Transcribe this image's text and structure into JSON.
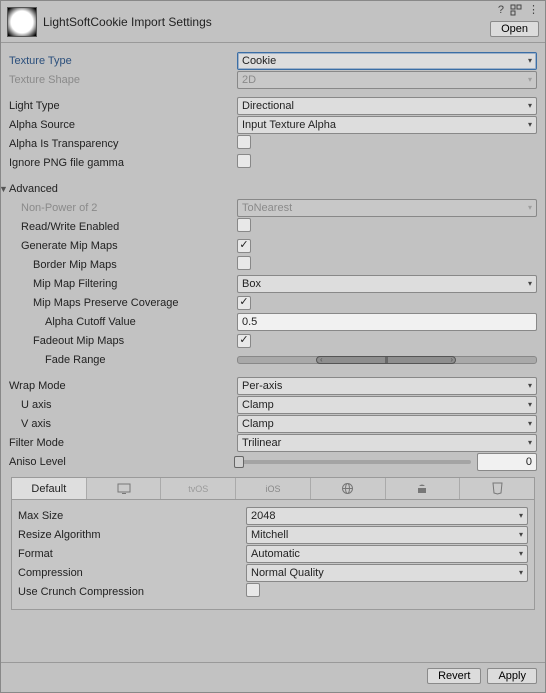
{
  "header": {
    "title": "LightSoftCookie Import Settings",
    "open": "Open"
  },
  "labels": {
    "textureType": "Texture Type",
    "textureShape": "Texture Shape",
    "lightType": "Light Type",
    "alphaSource": "Alpha Source",
    "alphaIsTransparency": "Alpha Is Transparency",
    "ignorePNG": "Ignore PNG file gamma",
    "advanced": "Advanced",
    "npo2": "Non-Power of 2",
    "readWrite": "Read/Write Enabled",
    "genMip": "Generate Mip Maps",
    "borderMip": "Border Mip Maps",
    "mipFiltering": "Mip Map Filtering",
    "mipCoverage": "Mip Maps Preserve Coverage",
    "alphaCutoff": "Alpha Cutoff Value",
    "fadeoutMip": "Fadeout Mip Maps",
    "fadeRange": "Fade Range",
    "wrapMode": "Wrap Mode",
    "uAxis": "U axis",
    "vAxis": "V axis",
    "filterMode": "Filter Mode",
    "anisoLevel": "Aniso Level",
    "maxSize": "Max Size",
    "resizeAlg": "Resize Algorithm",
    "format": "Format",
    "compression": "Compression",
    "crunch": "Use Crunch Compression"
  },
  "values": {
    "textureType": "Cookie",
    "textureShape": "2D",
    "lightType": "Directional",
    "alphaSource": "Input Texture Alpha",
    "alphaIsTransparency": false,
    "ignorePNG": false,
    "npo2": "ToNearest",
    "readWrite": false,
    "genMip": true,
    "borderMip": false,
    "mipFiltering": "Box",
    "mipCoverage": true,
    "alphaCutoff": "0.5",
    "fadeoutMip": true,
    "wrapMode": "Per-axis",
    "uAxis": "Clamp",
    "vAxis": "Clamp",
    "filterMode": "Trilinear",
    "anisoLevel": "0",
    "maxSize": "2048",
    "resizeAlg": "Mitchell",
    "format": "Automatic",
    "compression": "Normal Quality",
    "crunch": false
  },
  "platforms": {
    "tabs": [
      "Default",
      "desktop",
      "tvOS",
      "iOS",
      "web",
      "android",
      "html5"
    ],
    "active": 0
  },
  "footer": {
    "revert": "Revert",
    "apply": "Apply"
  }
}
